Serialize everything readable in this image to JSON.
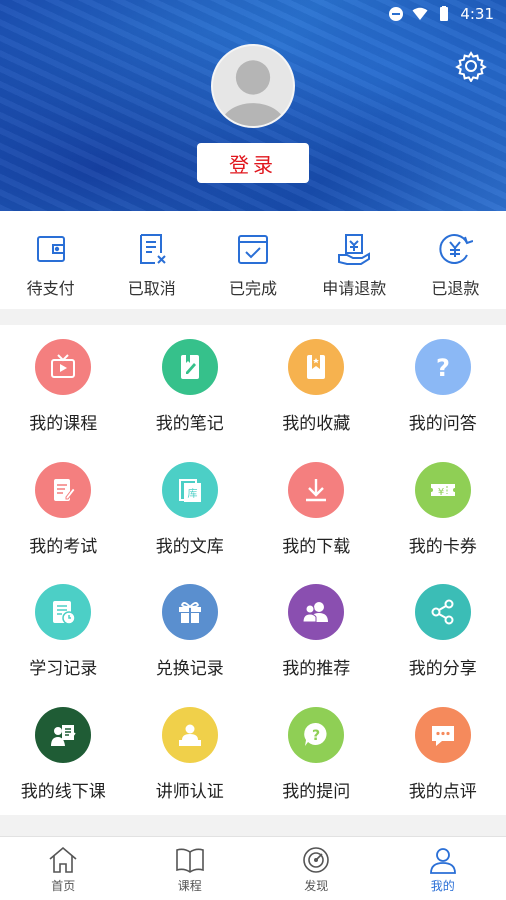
{
  "status_bar": {
    "time": "4:31"
  },
  "header": {
    "login_label": "登录"
  },
  "orders": [
    {
      "label": "待支付",
      "icon": "wallet-icon"
    },
    {
      "label": "已取消",
      "icon": "cancel-doc-icon"
    },
    {
      "label": "已完成",
      "icon": "completed-icon"
    },
    {
      "label": "申请退款",
      "icon": "refund-request-icon"
    },
    {
      "label": "已退款",
      "icon": "refunded-icon"
    }
  ],
  "grid": [
    {
      "label": "我的课程",
      "color": "#f47f7f",
      "icon": "tv-icon"
    },
    {
      "label": "我的笔记",
      "color": "#36c18b",
      "icon": "note-icon"
    },
    {
      "label": "我的收藏",
      "color": "#f6b24f",
      "icon": "bookmark-icon"
    },
    {
      "label": "我的问答",
      "color": "#8bb8f5",
      "icon": "question-icon"
    },
    {
      "label": "我的考试",
      "color": "#f47f7f",
      "icon": "exam-icon"
    },
    {
      "label": "我的文库",
      "color": "#4ccfc6",
      "icon": "library-icon"
    },
    {
      "label": "我的下载",
      "color": "#f47f7f",
      "icon": "download-icon"
    },
    {
      "label": "我的卡券",
      "color": "#8fcf55",
      "icon": "coupon-icon"
    },
    {
      "label": "学习记录",
      "color": "#4ccfc6",
      "icon": "study-record-icon"
    },
    {
      "label": "兑换记录",
      "color": "#5a8fcf",
      "icon": "gift-icon"
    },
    {
      "label": "我的推荐",
      "color": "#8a4fb0",
      "icon": "users-icon"
    },
    {
      "label": "我的分享",
      "color": "#3bbdb6",
      "icon": "share-icon"
    },
    {
      "label": "我的线下课",
      "color": "#1f5c35",
      "icon": "offline-class-icon"
    },
    {
      "label": "讲师认证",
      "color": "#f0d04a",
      "icon": "lecturer-icon"
    },
    {
      "label": "我的提问",
      "color": "#8fcf55",
      "icon": "ask-icon"
    },
    {
      "label": "我的点评",
      "color": "#f58a5c",
      "icon": "comment-icon"
    }
  ],
  "bottom_nav": [
    {
      "label": "首页",
      "icon": "home-icon"
    },
    {
      "label": "课程",
      "icon": "book-icon"
    },
    {
      "label": "发现",
      "icon": "discover-icon"
    },
    {
      "label": "我的",
      "icon": "profile-icon",
      "active": true
    }
  ]
}
